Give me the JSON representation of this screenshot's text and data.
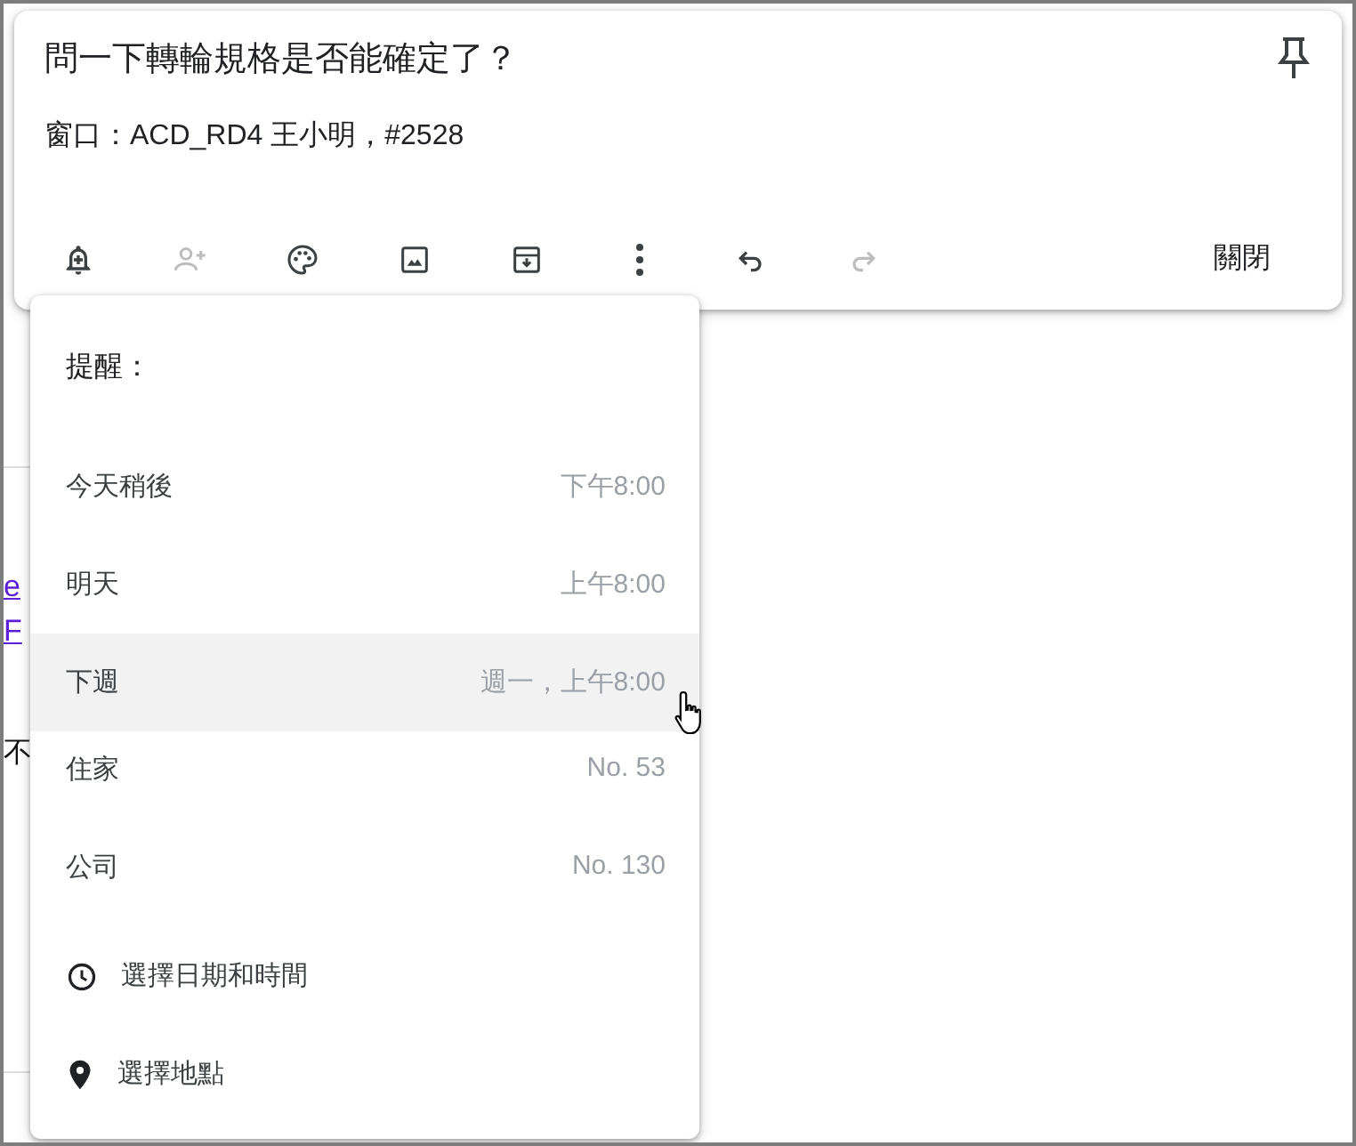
{
  "note": {
    "title": "問一下轉輪規格是否能確定了？",
    "body": "窗口：ACD_RD4 王小明，#2528",
    "toolbar": [
      {
        "disabled": false
      },
      {
        "disabled": true
      },
      {
        "disabled": false
      },
      {
        "disabled": false
      },
      {
        "disabled": false
      },
      {
        "disabled": false
      },
      {
        "disabled": false
      },
      {
        "disabled": true
      }
    ],
    "close_button": "關閉"
  },
  "background": {
    "links": [
      "e",
      "F"
    ],
    "text": "不"
  },
  "reminder_menu": {
    "title": "提醒：",
    "items": [
      {
        "kind": "time",
        "label": "今天稍後",
        "detail": "下午8:00",
        "selected": false
      },
      {
        "kind": "time",
        "label": "明天",
        "detail": "上午8:00",
        "selected": false
      },
      {
        "kind": "time",
        "label": "下週",
        "detail": "週一，上午8:00",
        "selected": true
      },
      {
        "kind": "place",
        "label": "住家",
        "detail": "No. 53",
        "selected": false
      },
      {
        "kind": "place",
        "label": "公司",
        "detail": "No. 130",
        "selected": false
      },
      {
        "kind": "datepick",
        "label": "選擇日期和時間",
        "selected": false
      },
      {
        "kind": "placepick",
        "label": "選擇地點",
        "selected": false
      }
    ]
  }
}
